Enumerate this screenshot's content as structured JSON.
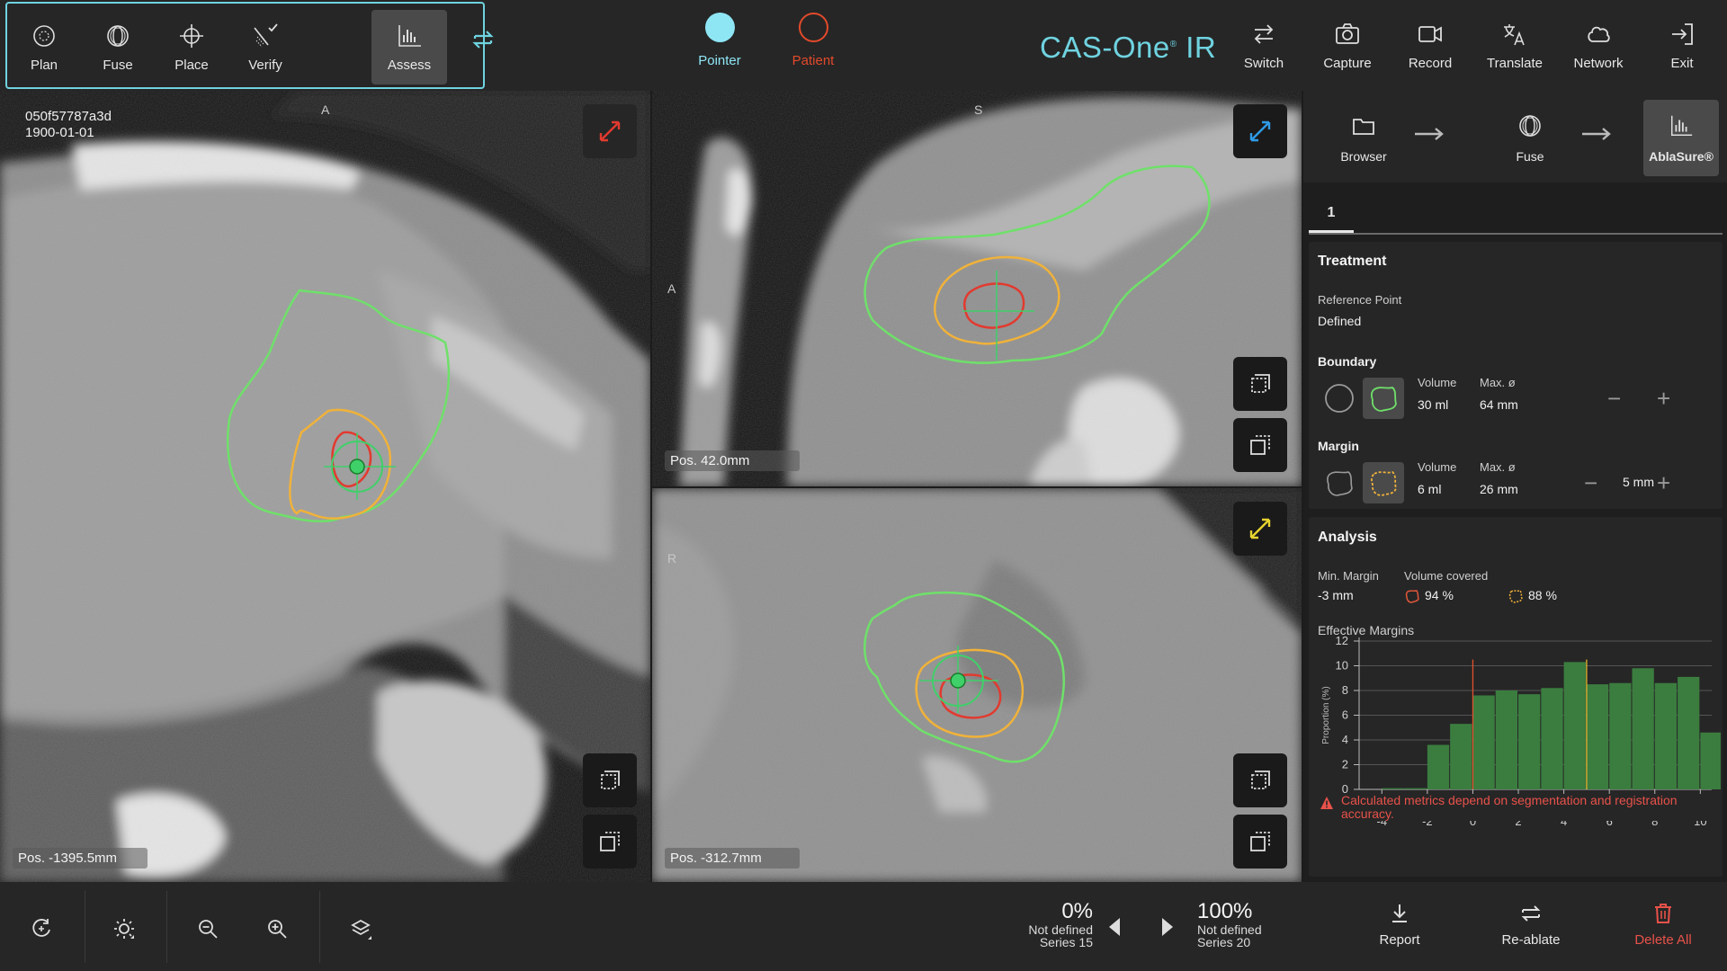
{
  "app": {
    "brand": "CAS-One",
    "brand_mark": "®",
    "brand_suffix": "IR"
  },
  "workflow": [
    {
      "label": "Plan",
      "icon": "plan-icon",
      "active": false
    },
    {
      "label": "Fuse",
      "icon": "fuse-icon",
      "active": false
    },
    {
      "label": "Place",
      "icon": "crosshair-icon",
      "active": false
    },
    {
      "label": "Verify",
      "icon": "verify-icon",
      "active": false
    },
    {
      "label": "Assess",
      "icon": "chart-icon",
      "active": true
    }
  ],
  "mode": {
    "pointer_label": "Pointer",
    "patient_label": "Patient",
    "pointer_color": "#8ee6f5",
    "patient_color": "#e24a2b"
  },
  "tools": [
    {
      "label": "Switch",
      "icon": "switch-icon"
    },
    {
      "label": "Capture",
      "icon": "camera-icon"
    },
    {
      "label": "Record",
      "icon": "video-icon"
    },
    {
      "label": "Translate",
      "icon": "translate-icon"
    },
    {
      "label": "Network",
      "icon": "cloud-icon"
    },
    {
      "label": "Exit",
      "icon": "exit-icon"
    }
  ],
  "viewports": {
    "axial": {
      "patient_id": "050f57787a3d",
      "date": "1900-01-01",
      "orient_top": "A",
      "position": "Pos. -1395.5mm",
      "expand_color": "#e23a2f"
    },
    "sagittal": {
      "orient_top": "S",
      "orient_left": "A",
      "position": "Pos. 42.0mm",
      "expand_color": "#2f9be6"
    },
    "coronal": {
      "orient_left": "R",
      "position": "Pos. -312.7mm",
      "expand_color": "#e6d32f"
    }
  },
  "steps": [
    {
      "label": "Browser",
      "icon": "folder-icon",
      "active": false
    },
    {
      "label": "Fuse",
      "icon": "fuse-icon",
      "active": false
    },
    {
      "label": "AblaSure®",
      "icon": "chart-icon",
      "active": true
    }
  ],
  "tabs": [
    {
      "label": "1"
    }
  ],
  "treatment": {
    "title": "Treatment",
    "reference_point_label": "Reference Point",
    "reference_point_value": "Defined",
    "boundary": {
      "title": "Boundary",
      "volume_label": "Volume",
      "volume": "30 ml",
      "max_label": "Max. ø",
      "max": "64 mm"
    },
    "margin": {
      "title": "Margin",
      "volume_label": "Volume",
      "volume": "6 ml",
      "max_label": "Max. ø",
      "max": "26 mm",
      "margin_value": "5 mm"
    }
  },
  "analysis": {
    "title": "Analysis",
    "min_margin_label": "Min. Margin",
    "min_margin": "-3 mm",
    "volume_covered_label": "Volume covered",
    "covered_boundary": "94 %",
    "covered_margin": "88 %",
    "effective_margins_label": "Effective Margins",
    "warning": "Calculated metrics depend on segmentation and registration accuracy."
  },
  "chart_data": {
    "type": "bar",
    "title": "Effective Margins",
    "ylabel": "Proportion (%)",
    "xlabel": "",
    "ylim": [
      0,
      12
    ],
    "xlim": [
      -5,
      10.5
    ],
    "yticks": [
      0,
      2,
      4,
      6,
      8,
      10,
      12
    ],
    "xticks": [
      -4,
      -2,
      0,
      2,
      4,
      6,
      8,
      10
    ],
    "bin_width": 1,
    "bins": [
      -4,
      -3,
      -2,
      -1,
      0,
      1,
      2,
      3,
      4,
      5,
      6,
      7,
      8,
      9,
      10
    ],
    "values": [
      0.1,
      0.1,
      3.6,
      5.3,
      7.6,
      8.0,
      7.7,
      8.2,
      10.3,
      8.5,
      8.6,
      9.8,
      8.6,
      9.1,
      4.6
    ],
    "bar_color": "#3b7d3f",
    "reference_lines": [
      {
        "x": 0,
        "color": "#e0522f"
      },
      {
        "x": 5,
        "color": "#e6b82f"
      }
    ],
    "grid": true
  },
  "bottom": {
    "series_left": {
      "pct": "0%",
      "label": "Not defined",
      "series": "Series 15"
    },
    "series_right": {
      "pct": "100%",
      "label": "Not defined",
      "series": "Series 20"
    }
  },
  "actions": [
    {
      "label": "Report",
      "icon": "download-icon",
      "color": "#e8e8e8"
    },
    {
      "label": "Re-ablate",
      "icon": "reablate-icon",
      "color": "#e8e8e8"
    },
    {
      "label": "Delete All",
      "icon": "trash-icon",
      "color": "#e8524a"
    }
  ]
}
